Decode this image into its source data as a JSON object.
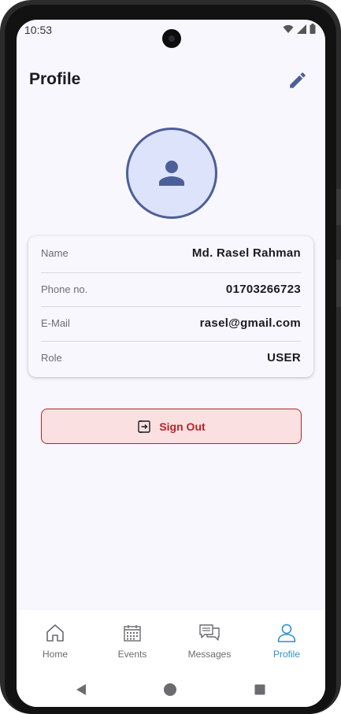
{
  "status_bar": {
    "time": "10:53",
    "icons": [
      "wifi-icon",
      "signal-icon",
      "battery-icon"
    ]
  },
  "header": {
    "title": "Profile",
    "edit_icon": "pencil-icon"
  },
  "avatar": {
    "icon": "person-icon"
  },
  "profile_fields": [
    {
      "label": "Name",
      "value": "Md. Rasel Rahman"
    },
    {
      "label": "Phone no.",
      "value": "01703266723"
    },
    {
      "label": "E-Mail",
      "value": "rasel@gmail.com"
    },
    {
      "label": "Role",
      "value": "USER"
    }
  ],
  "sign_out": {
    "label": "Sign Out",
    "icon": "logout-icon"
  },
  "bottom_nav": {
    "items": [
      {
        "label": "Home",
        "icon": "home-icon"
      },
      {
        "label": "Events",
        "icon": "calendar-icon"
      },
      {
        "label": "Messages",
        "icon": "chat-icon"
      },
      {
        "label": "Profile",
        "icon": "person-outline-icon",
        "active": true
      }
    ]
  },
  "system_nav": [
    "back-icon",
    "home-circle-icon",
    "recents-icon"
  ],
  "colors": {
    "accent": "#4d5f99",
    "avatar_bg": "#dde3fb",
    "danger": "#b3262d",
    "danger_bg": "#fae0e0",
    "nav_active": "#2d91cf",
    "background": "#f8f7fd"
  }
}
